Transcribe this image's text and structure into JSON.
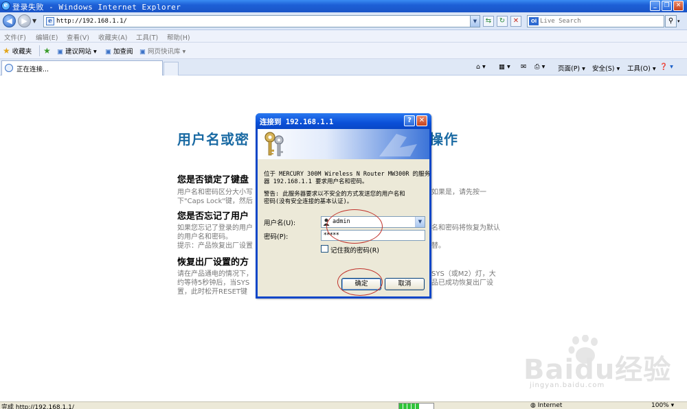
{
  "window": {
    "title": "登录失败 - Windows Internet Explorer"
  },
  "address": {
    "url": "http://192.168.1.1/"
  },
  "search": {
    "placeholder": "Live Search"
  },
  "menu": [
    "文件(F)",
    "编辑(E)",
    "查看(V)",
    "收藏夹(A)",
    "工具(T)",
    "帮助(H)"
  ],
  "favorites": {
    "label": "收藏夹",
    "items": [
      "建议网站 ▾",
      "加查阅",
      "网页快讯库 ▾"
    ]
  },
  "tab": {
    "label": "正在连接..."
  },
  "commands": {
    "page": "页面(P) ▾",
    "safety": "安全(S) ▾",
    "tools": "工具(O) ▾"
  },
  "content": {
    "heading_left": "用户名或密",
    "heading_right": "操作",
    "section1_title": "您是否锁定了键盘",
    "section1_line1_left": "用户名和密码区分大小写",
    "section1_line1_right": "如果是，请先按一",
    "section1_line2": "下\"Caps Lock\"键，然后",
    "section2_title": "您是否忘记了用户",
    "section2_line1_left": "如果您忘记了登录的用户",
    "section2_line1_right": "名和密码将恢复为默认",
    "section2_line2": "的用户名和密码。",
    "section2_line3_left": "提示：产品恢复出厂设置",
    "section2_line3_right": "替。",
    "section3_title": "恢复出厂设置的方",
    "section3_line1_left": "请在产品通电的情况下，",
    "section3_line1_right": "SYS（或M2）灯，大",
    "section3_line2_left": "约等待5秒钟后，当SYS",
    "section3_line2_right": "品已成功恢复出厂设",
    "section3_line3": "置，此时松开RESET键"
  },
  "dialog": {
    "title": "连接到 192.168.1.1",
    "message_line1": "位于 MERCURY 300M Wireless N Router MW300R 的服务",
    "message_line2": "器 192.168.1.1 要求用户名和密码。",
    "warning_line1": "警告: 此服务器要求以不安全的方式发送您的用户名和",
    "warning_line2": "密码(没有安全连接的基本认证)。",
    "username_label": "用户名(U):",
    "username_value": "admin",
    "password_label": "密码(P):",
    "password_value": "*****",
    "remember_label": "记住我的密码(R)",
    "remember_checked": false,
    "ok_label": "确定",
    "cancel_label": "取消"
  },
  "watermark": {
    "text": "Baidu经验",
    "sub": "jingyan.baidu.com"
  },
  "status": {
    "text": "完成 http://192.168.1.1/",
    "zone": "Internet",
    "zoom": "100% ▾",
    "progress": 0.6
  },
  "colors": {
    "title_blue": "#0b50d8",
    "heading": "#1a6aa3",
    "annotation_red": "#c0312a"
  }
}
